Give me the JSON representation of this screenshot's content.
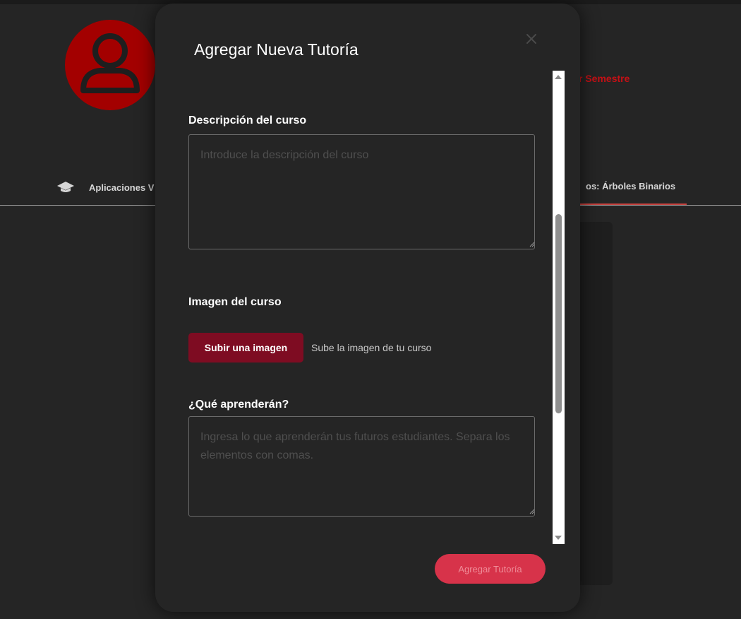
{
  "background": {
    "semester_link": "r Semestre",
    "course_tab_left": "Aplicaciones V",
    "course_tab_right": "os: Árboles Binarios"
  },
  "modal": {
    "title": "Agregar Nueva Tutoría",
    "description": {
      "label": "Descripción del curso",
      "placeholder": "Introduce la descripción del curso",
      "value": ""
    },
    "image": {
      "label": "Imagen del curso",
      "upload_button": "Subir una imagen",
      "hint": "Sube la imagen de tu curso"
    },
    "learn": {
      "label": "¿Qué aprenderán?",
      "placeholder": "Ingresa lo que aprenderán tus futuros estudiantes. Separa los elementos con comas.",
      "value": ""
    },
    "submit_button": "Agregar Tutoría"
  },
  "icons": {
    "avatar": "user-silhouette-icon",
    "course": "graduation-cap-icon",
    "close": "close-icon"
  },
  "colors": {
    "background": "#252525",
    "avatar": "#a30000",
    "accent_link": "#c61015",
    "upload_button": "#7e0c22",
    "submit_button": "#d7334a"
  }
}
